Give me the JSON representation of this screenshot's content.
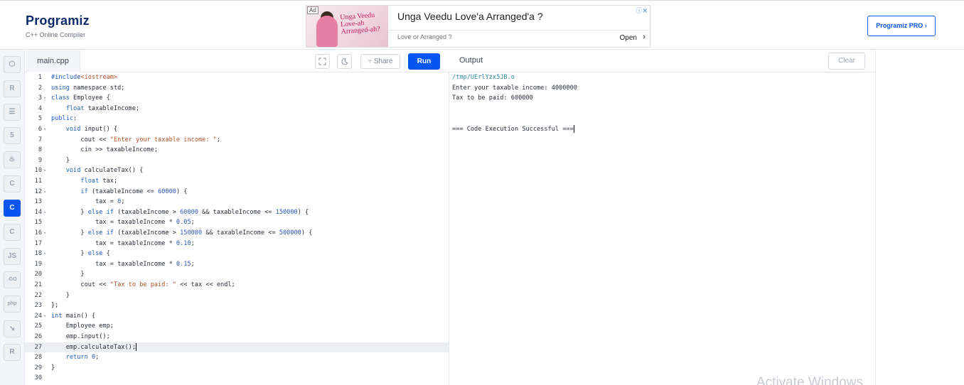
{
  "header": {
    "logo_text": "Programiz",
    "subtitle": "C++ Online Compiler",
    "pro_button": "Programiz PRO ›"
  },
  "ad": {
    "badge": "Ad",
    "image_text": "Unga Veedu Love-ah Arranged-ah?",
    "title": "Unga Veedu Love'a Arranged'a ?",
    "subtitle": "Love or Arranged ?",
    "open_label": "Open",
    "open_icon": "›",
    "corner_icons": "ⓘ✕"
  },
  "sidebar": {
    "languages": [
      {
        "name": "python-icon",
        "glyph": "⬡"
      },
      {
        "name": "r-icon",
        "glyph": "R"
      },
      {
        "name": "sql-icon",
        "glyph": "☰"
      },
      {
        "name": "html-icon",
        "glyph": "5"
      },
      {
        "name": "java-icon",
        "glyph": "♨"
      },
      {
        "name": "c-icon",
        "glyph": "C"
      },
      {
        "name": "cpp-icon",
        "glyph": "C"
      },
      {
        "name": "csharp-icon",
        "glyph": "C"
      },
      {
        "name": "js-icon",
        "glyph": "JS"
      },
      {
        "name": "go-icon",
        "glyph": "-GO"
      },
      {
        "name": "php-icon",
        "glyph": "php"
      },
      {
        "name": "swift-icon",
        "glyph": "↘"
      },
      {
        "name": "rust-icon",
        "glyph": "R"
      }
    ]
  },
  "editor": {
    "tab_name": "main.cpp",
    "share_label": "Share",
    "run_label": "Run",
    "active_line": 27
  },
  "output": {
    "title": "Output",
    "clear_label": "Clear",
    "lines": [
      "/tmp/UErlYzx5JB.o",
      "Enter your taxable income: 4000000",
      "Tax to be paid: 600000",
      "",
      "",
      "=== Code Execution Successful ==="
    ],
    "watermark": "Activate Windows"
  },
  "colors": {
    "brand_blue": "#0556f3",
    "path_color": "#2f8aa1"
  }
}
